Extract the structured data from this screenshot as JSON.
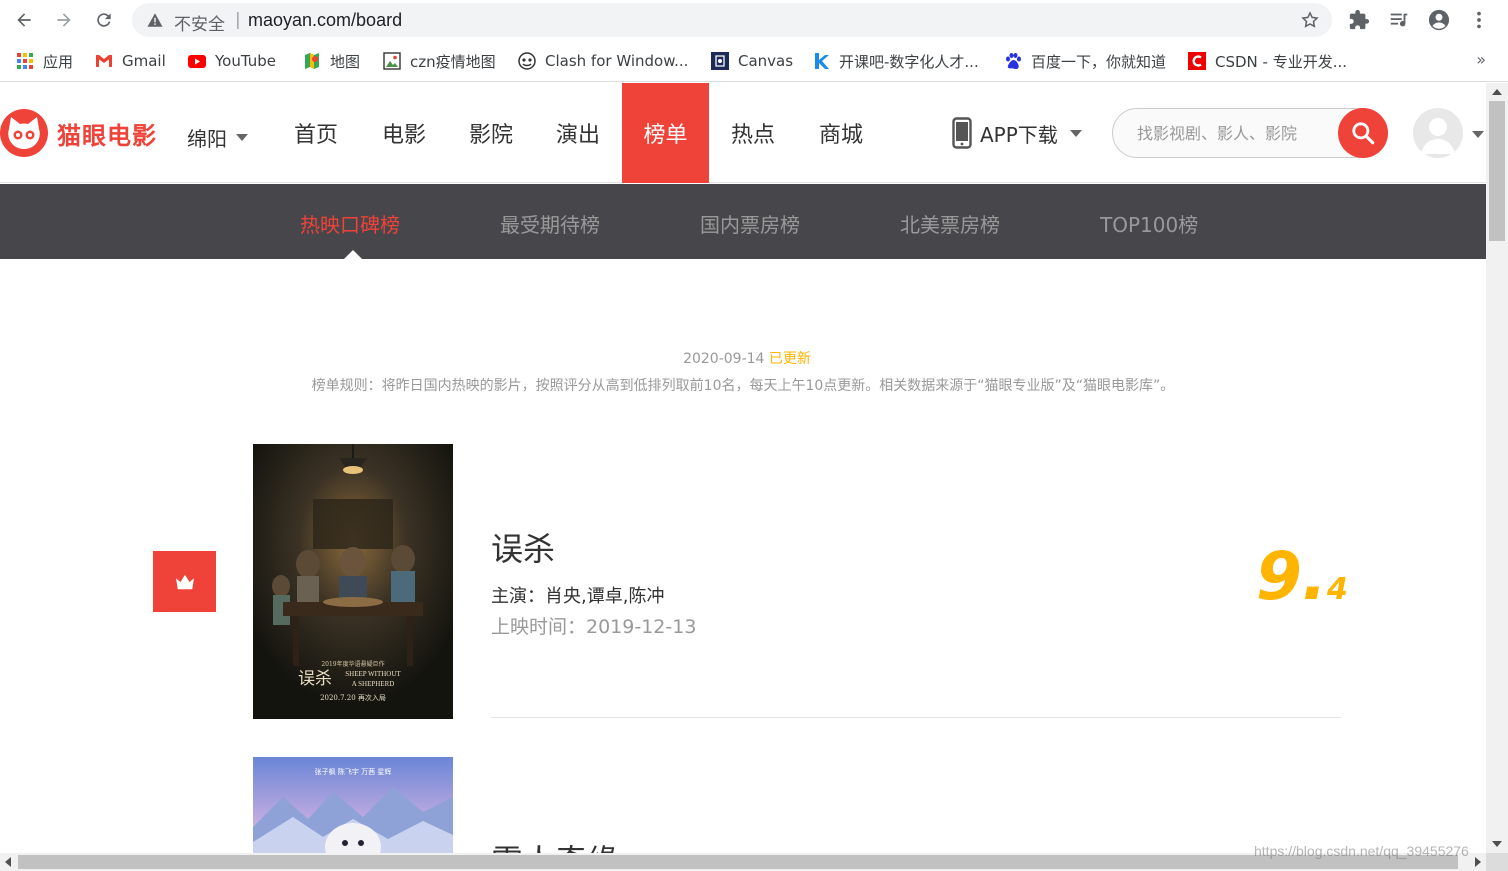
{
  "browser": {
    "insecure_label": "不安全",
    "separator": "|",
    "url": "maoyan.com/board",
    "bookmarks": [
      {
        "label": "应用",
        "icon": "apps-grid-icon"
      },
      {
        "label": "Gmail",
        "icon": "gmail-icon"
      },
      {
        "label": "YouTube",
        "icon": "youtube-icon"
      },
      {
        "label": "地图",
        "icon": "maps-icon"
      },
      {
        "label": "czn疫情地图",
        "icon": "image-bookmark-icon"
      },
      {
        "label": "Clash for Window...",
        "icon": "clash-icon"
      },
      {
        "label": "Canvas",
        "icon": "canvas-icon"
      },
      {
        "label": "开课吧-数字化人才...",
        "icon": "kaikeba-icon"
      },
      {
        "label": "百度一下，你就知道",
        "icon": "baidu-paw-icon"
      },
      {
        "label": "CSDN - 专业开发...",
        "icon": "csdn-icon"
      }
    ],
    "bookmarks_more": "»"
  },
  "site": {
    "logo_text": "猫眼电影",
    "city": "绵阳",
    "nav": [
      "首页",
      "电影",
      "影院",
      "演出",
      "榜单",
      "热点",
      "商城"
    ],
    "active_nav": "榜单",
    "app_download": "APP下载",
    "search_placeholder": "找影视剧、影人、影院"
  },
  "subnav": {
    "items": [
      "热映口碑榜",
      "最受期待榜",
      "国内票房榜",
      "北美票房榜",
      "TOP100榜"
    ],
    "active": "热映口碑榜"
  },
  "board": {
    "date": "2020-09-14",
    "updated_label": "已更新",
    "rule": "榜单规则：将昨日国内热映的影片，按照评分从高到低排列取前10名，每天上午10点更新。相关数据来源于“猫眼专业版”及“猫眼电影库”。",
    "movies": [
      {
        "title": "误杀",
        "stars": "主演：肖央,谭卓,陈冲",
        "release": "上映时间：2019-12-13",
        "score_int": "9.",
        "score_frac": "4",
        "poster_text_1": "误杀",
        "poster_text_2": "SHEEP WITHOUT",
        "poster_text_3": "A SHEPHERD",
        "poster_text_4": "2020.7.20  再次入局"
      },
      {
        "title": "雪人奇缘"
      }
    ]
  },
  "watermark": "https://blog.csdn.net/qq_39455276",
  "colors": {
    "brand": "#ef4238",
    "subnav_bg": "#47464a",
    "score": "#ffb400"
  }
}
